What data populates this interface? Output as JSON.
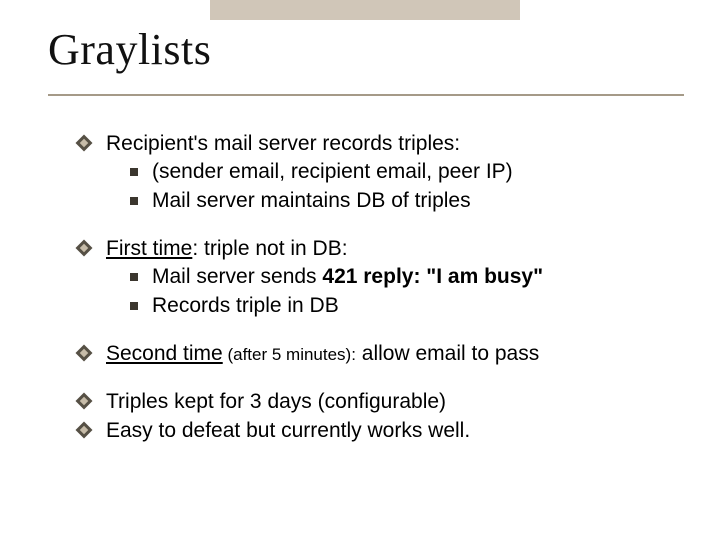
{
  "title": "Graylists",
  "bullets": {
    "b1": {
      "text": "Recipient's mail server records triples:",
      "sub": [
        "(sender email,  recipient email,  peer IP)",
        "Mail server maintains DB of triples"
      ]
    },
    "b2": {
      "lead_ul": "First time",
      "lead_rest": ":    triple not in DB:",
      "sub1_a": "Mail server sends ",
      "sub1_b": "  421  reply:",
      "sub1_c": "    \"I am busy\"",
      "sub2": "Records triple in DB"
    },
    "b3": {
      "lead_ul": "Second time",
      "paren": " (after 5 minutes):",
      "rest": "    allow email to pass"
    },
    "b4": "Triples kept for 3 days   (configurable)",
    "b5": "Easy to defeat but currently works well."
  }
}
